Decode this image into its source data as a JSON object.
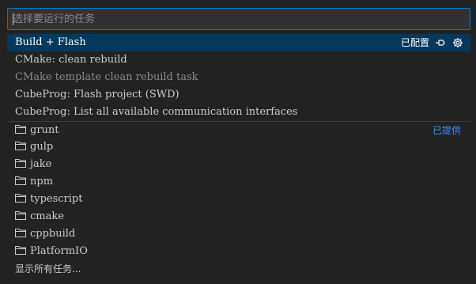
{
  "search": {
    "placeholder": "选择要运行的任务"
  },
  "configured_tasks": [
    {
      "label": "Build + Flash",
      "selected": true,
      "disabled": false
    },
    {
      "label": "CMake: clean rebuild",
      "selected": false,
      "disabled": false
    },
    {
      "label": "CMake template clean rebuild task",
      "selected": false,
      "disabled": true
    },
    {
      "label": "CubeProg: Flash project (SWD)",
      "selected": false,
      "disabled": false
    },
    {
      "label": "CubeProg: List all available communication interfaces",
      "selected": false,
      "disabled": false
    }
  ],
  "selected_row": {
    "tag": "已配置",
    "pin_icon": "pin-icon",
    "gear_icon": "gear-icon"
  },
  "provider_group": {
    "tag": "已提供",
    "folder_icon": "folder-icon",
    "items": [
      "grunt",
      "gulp",
      "jake",
      "npm",
      "typescript",
      "cmake",
      "cppbuild",
      "PlatformIO"
    ]
  },
  "show_all": {
    "label": "显示所有任务..."
  },
  "colors": {
    "accent": "#0078d4",
    "selection": "#04395e",
    "link": "#3794ff",
    "background": "#222222"
  }
}
